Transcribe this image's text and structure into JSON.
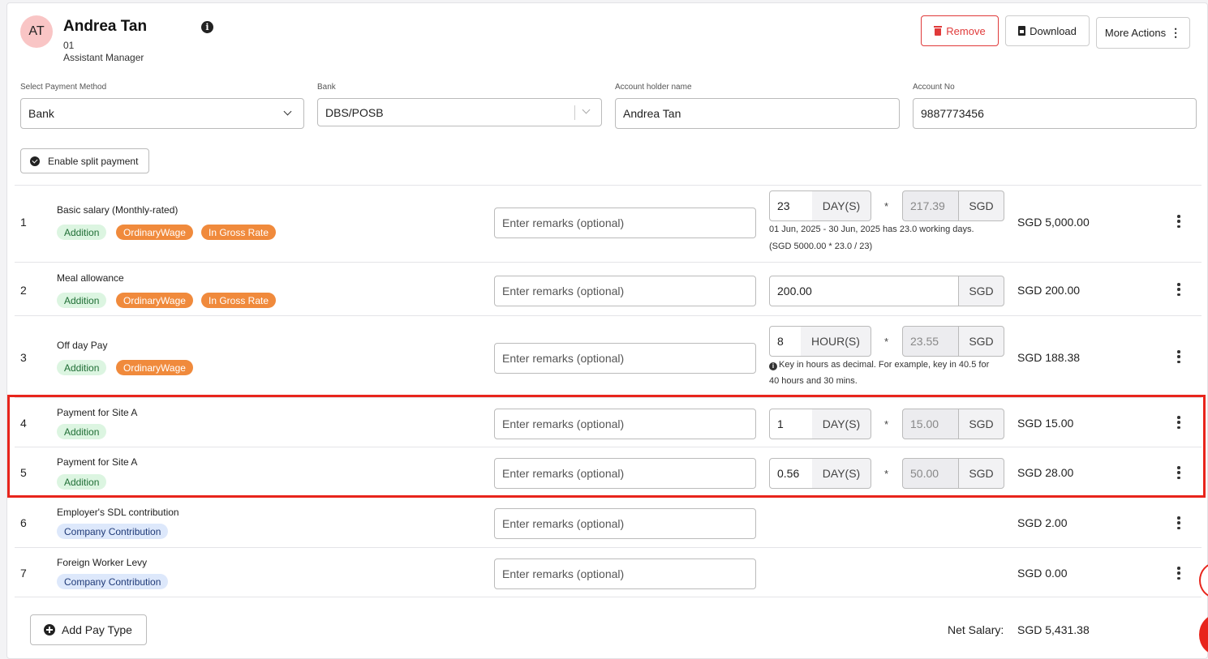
{
  "employee": {
    "initials": "AT",
    "name": "Andrea Tan",
    "id": "01",
    "role": "Assistant Manager"
  },
  "actions": {
    "remove": "Remove",
    "download": "Download",
    "more": "More Actions"
  },
  "payment": {
    "method_label": "Select Payment Method",
    "method_value": "Bank",
    "bank_label": "Bank",
    "bank_value": "DBS/POSB",
    "holder_label": "Account holder name",
    "holder_value": "Andrea Tan",
    "account_label": "Account No",
    "account_value": "9887773456"
  },
  "split_payment_label": "Enable split payment",
  "remarks_placeholder": "Enter remarks (optional)",
  "items": [
    {
      "num": "1",
      "title": "Basic salary (Monthly-rated)",
      "tags": [
        "Addition",
        "OrdinaryWage",
        "In Gross Rate"
      ],
      "qty": "23",
      "unit": "DAY(S)",
      "rate": "217.39",
      "currency": "SGD",
      "amount": "SGD 5,000.00",
      "note1": "01 Jun, 2025 - 30 Jun, 2025 has 23.0 working days.",
      "note2": "(SGD 5000.00 * 23.0 / 23)"
    },
    {
      "num": "2",
      "title": "Meal allowance",
      "tags": [
        "Addition",
        "OrdinaryWage",
        "In Gross Rate"
      ],
      "value": "200.00",
      "currency": "SGD",
      "amount": "SGD 200.00"
    },
    {
      "num": "3",
      "title": "Off day Pay",
      "tags": [
        "Addition",
        "OrdinaryWage"
      ],
      "qty": "8",
      "unit": "HOUR(S)",
      "rate": "23.55",
      "currency": "SGD",
      "amount": "SGD 188.38",
      "note1": "Key in hours as decimal. For example, key in 40.5 for",
      "note2": "40 hours and 30 mins."
    },
    {
      "num": "4",
      "title": "Payment for Site A",
      "tags": [
        "Addition"
      ],
      "qty": "1",
      "unit": "DAY(S)",
      "rate": "15.00",
      "currency": "SGD",
      "amount": "SGD 15.00"
    },
    {
      "num": "5",
      "title": "Payment for Site A",
      "tags": [
        "Addition"
      ],
      "qty": "0.56",
      "unit": "DAY(S)",
      "rate": "50.00",
      "currency": "SGD",
      "amount": "SGD 28.00"
    },
    {
      "num": "6",
      "title": "Employer's SDL contribution",
      "tags": [
        "Company Contribution"
      ],
      "amount": "SGD 2.00"
    },
    {
      "num": "7",
      "title": "Foreign Worker Levy",
      "tags": [
        "Company Contribution"
      ],
      "amount": "SGD 0.00"
    }
  ],
  "add_pay_type": "Add Pay Type",
  "net_salary_label": "Net Salary:",
  "net_salary_value": "SGD 5,431.38",
  "colors": {
    "accent_red": "#e8251c",
    "ordinary_wage_tag": "#f08a3c",
    "addition_tag": "#dcf5e1",
    "company_contribution_tag": "#dde8fb"
  }
}
